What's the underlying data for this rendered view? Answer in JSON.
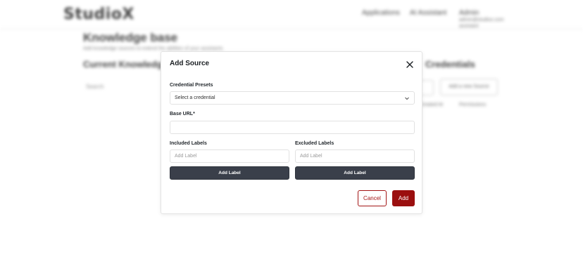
{
  "app": {
    "logo": "StudioX",
    "nav": [
      "Applications",
      "AI Assistant",
      "Admin"
    ],
    "user_sub": "admin@studiox.com assistant"
  },
  "background": {
    "title": "Knowledge base",
    "subtitle": "Add knowledge sources to extend the abilities of your assistants",
    "section_left": "Current Knowledge",
    "section_right": "Credentials",
    "search_placeholder": "Search",
    "add_button": "Add a new Source",
    "col1": "Created At",
    "col2": "Permissions"
  },
  "modal": {
    "title": "Add Source",
    "credential_label": "Credential Presets",
    "credential_value": "Select a credential",
    "base_url_label": "Base URL*",
    "base_url_value": "",
    "included_label": "Included Labels",
    "included_placeholder": "Add Label",
    "included_button": "Add Label",
    "excluded_label": "Excluded Labels",
    "excluded_placeholder": "Add Label",
    "excluded_button": "Add Label",
    "cancel": "Cancel",
    "add": "Add"
  },
  "colors": {
    "primary": "#9b0f0f",
    "dark_button": "#3a3f4a"
  }
}
